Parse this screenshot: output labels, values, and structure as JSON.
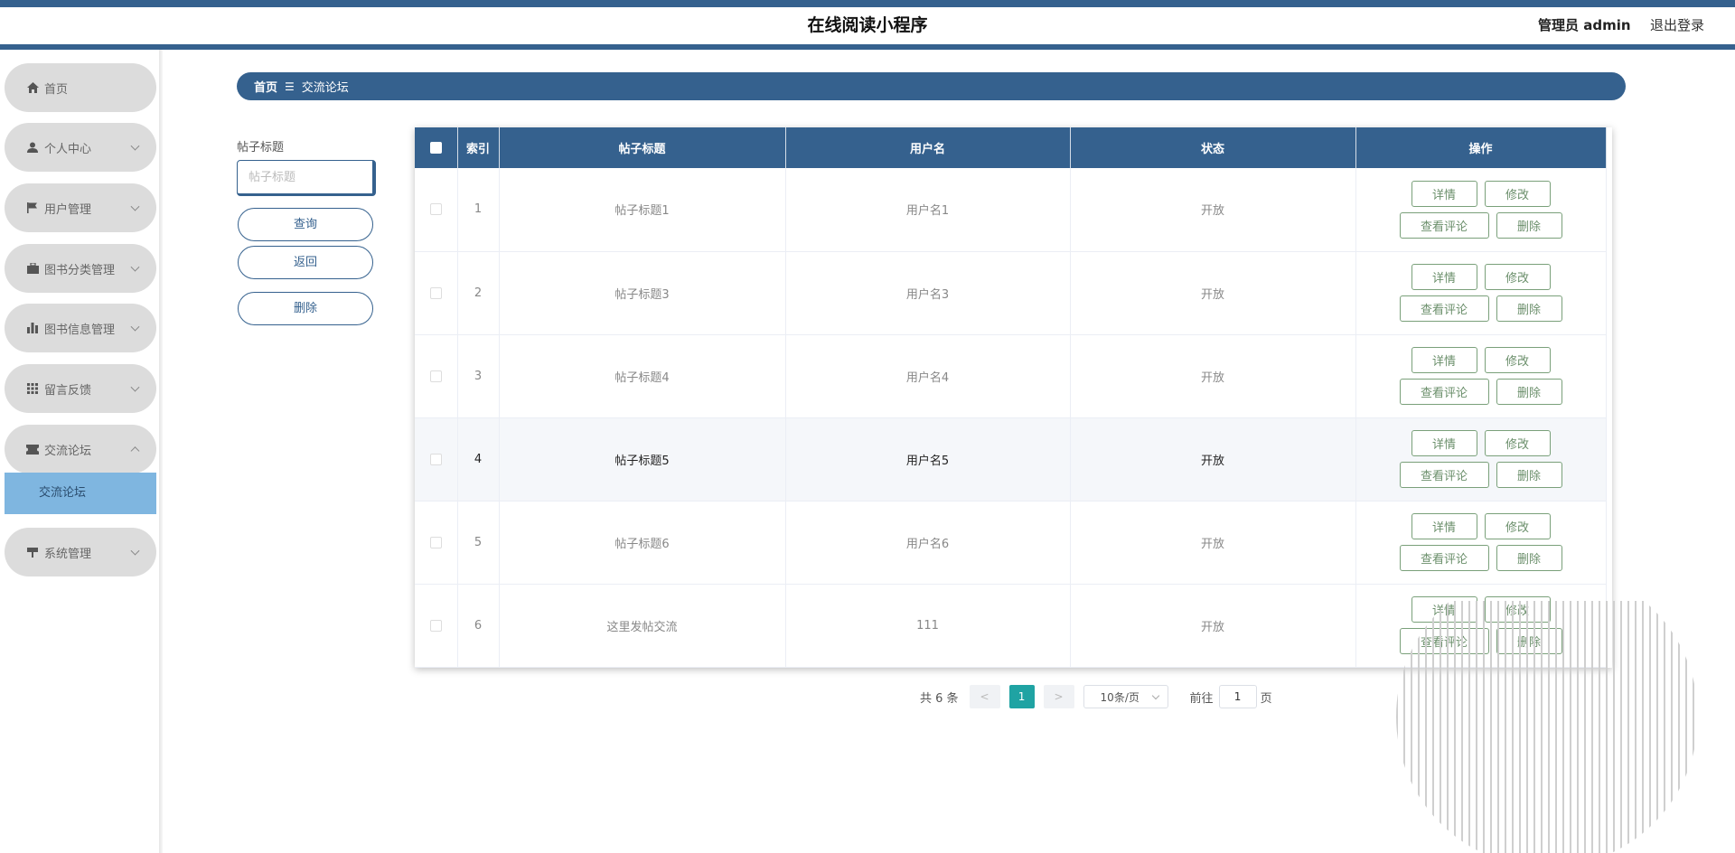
{
  "header": {
    "title": "在线阅读小程序",
    "admin": "管理员 admin",
    "logout": "退出登录"
  },
  "sidebar": {
    "items": [
      {
        "label": "首页",
        "icon": "home-icon"
      },
      {
        "label": "个人中心",
        "icon": "user-icon"
      },
      {
        "label": "用户管理",
        "icon": "flag-icon"
      },
      {
        "label": "图书分类管理",
        "icon": "briefcase-icon"
      },
      {
        "label": "图书信息管理",
        "icon": "bar-chart-icon"
      },
      {
        "label": "留言反馈",
        "icon": "grid-icon"
      },
      {
        "label": "交流论坛",
        "icon": "ticket-icon"
      },
      {
        "label": "系统管理",
        "icon": "signpost-icon"
      }
    ],
    "subitem": "交流论坛"
  },
  "breadcrumb": {
    "home": "首页",
    "separator": "☰",
    "current": "交流论坛"
  },
  "search": {
    "label": "帖子标题",
    "placeholder": "帖子标题",
    "query_btn": "查询",
    "back_btn": "返回",
    "delete_btn": "删除"
  },
  "table": {
    "headers": {
      "index": "索引",
      "title": "帖子标题",
      "username": "用户名",
      "status": "状态",
      "actions": "操作"
    },
    "rows": [
      {
        "index": "1",
        "title": "帖子标题1",
        "username": "用户名1",
        "status": "开放"
      },
      {
        "index": "2",
        "title": "帖子标题3",
        "username": "用户名3",
        "status": "开放"
      },
      {
        "index": "3",
        "title": "帖子标题4",
        "username": "用户名4",
        "status": "开放"
      },
      {
        "index": "4",
        "title": "帖子标题5",
        "username": "用户名5",
        "status": "开放"
      },
      {
        "index": "5",
        "title": "帖子标题6",
        "username": "用户名6",
        "status": "开放"
      },
      {
        "index": "6",
        "title": "这里发帖交流",
        "username": "111",
        "status": "开放"
      }
    ],
    "highlighted_row": 4,
    "actions": {
      "detail": "详情",
      "edit": "修改",
      "comments": "查看评论",
      "delete": "删除"
    }
  },
  "pagination": {
    "total": "共 6 条",
    "prev": "<",
    "current_page": "1",
    "next": ">",
    "page_size": "10条/页",
    "goto_label": "前往",
    "goto_value": "1",
    "page_suffix": "页"
  },
  "colors": {
    "primary": "#35618e",
    "submenu_active": "#7fb6e0",
    "pager_active": "#1fa3a3",
    "action_border": "#7aa07a"
  }
}
